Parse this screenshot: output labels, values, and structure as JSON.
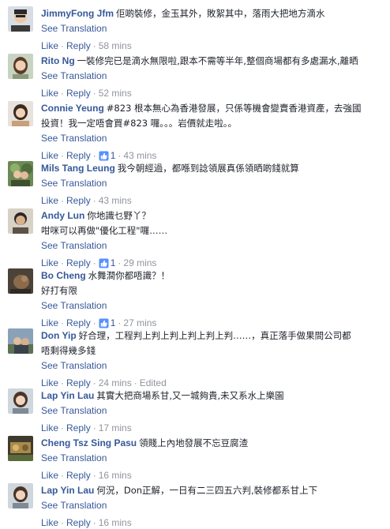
{
  "ui": {
    "see_translation": "See Translation",
    "like": "Like",
    "reply": "Reply",
    "separator": "·"
  },
  "comments": [
    {
      "author": "JimmyFong Jfm",
      "text": "佢啲裝修，金玉其外，敗絮其中，落雨大把地方滴水",
      "text2": "",
      "likes": "",
      "time": "58 mins",
      "edited": ""
    },
    {
      "author": "Rito Ng",
      "text": "一裝修完已是滴水無限啦,跟本不需等半年,整個商場都有多處漏水,離晒",
      "text2": "",
      "likes": "",
      "time": "52 mins",
      "edited": ""
    },
    {
      "author": "Connie Yeung",
      "text": "#823 根本無心為香港發展，只係等機會變賣香港資產，去強國",
      "text2": "投資！我一定唔會買#823 囉。。。岩價就走啦。。",
      "likes": "1",
      "time": "43 mins",
      "edited": ""
    },
    {
      "author": "Mils Tang Leung",
      "text": "我今朝經過，都喺到諗領展真係領晒啲錢就算",
      "text2": "",
      "likes": "",
      "time": "43 mins",
      "edited": ""
    },
    {
      "author": "Andy Lun",
      "text": "你地識乜野丫？",
      "text2": "咁咪可以再做\"優化工程\"囉……",
      "likes": "1",
      "time": "29 mins",
      "edited": ""
    },
    {
      "author": "Bo Cheng",
      "text": "水舞澗你都唔識？！",
      "text2": "好打有限",
      "likes": "1",
      "time": "27 mins",
      "edited": ""
    },
    {
      "author": "Don Yip",
      "text": "好合理，工程判上判上判上判上判上判……，真正落手做果間公司都",
      "text2": "唔剩得幾多錢",
      "likes": "",
      "time": "24 mins",
      "edited": "Edited"
    },
    {
      "author": "Lap Yin Lau",
      "text": "其實大把商場系甘,又一城夠貴,未又系水上樂園",
      "text2": "",
      "likes": "",
      "time": "17 mins",
      "edited": ""
    },
    {
      "author": "Cheng Tsz Sing Pasu",
      "text": "領賤上內地發展不忘豆腐渣",
      "text2": "",
      "likes": "",
      "time": "16 mins",
      "edited": ""
    },
    {
      "author": "Lap Yin Lau",
      "text": "何況，Don正解，一日有二三四五六判,裝修都系甘上下",
      "text2": "",
      "likes": "",
      "time": "16 mins",
      "edited": ""
    }
  ]
}
